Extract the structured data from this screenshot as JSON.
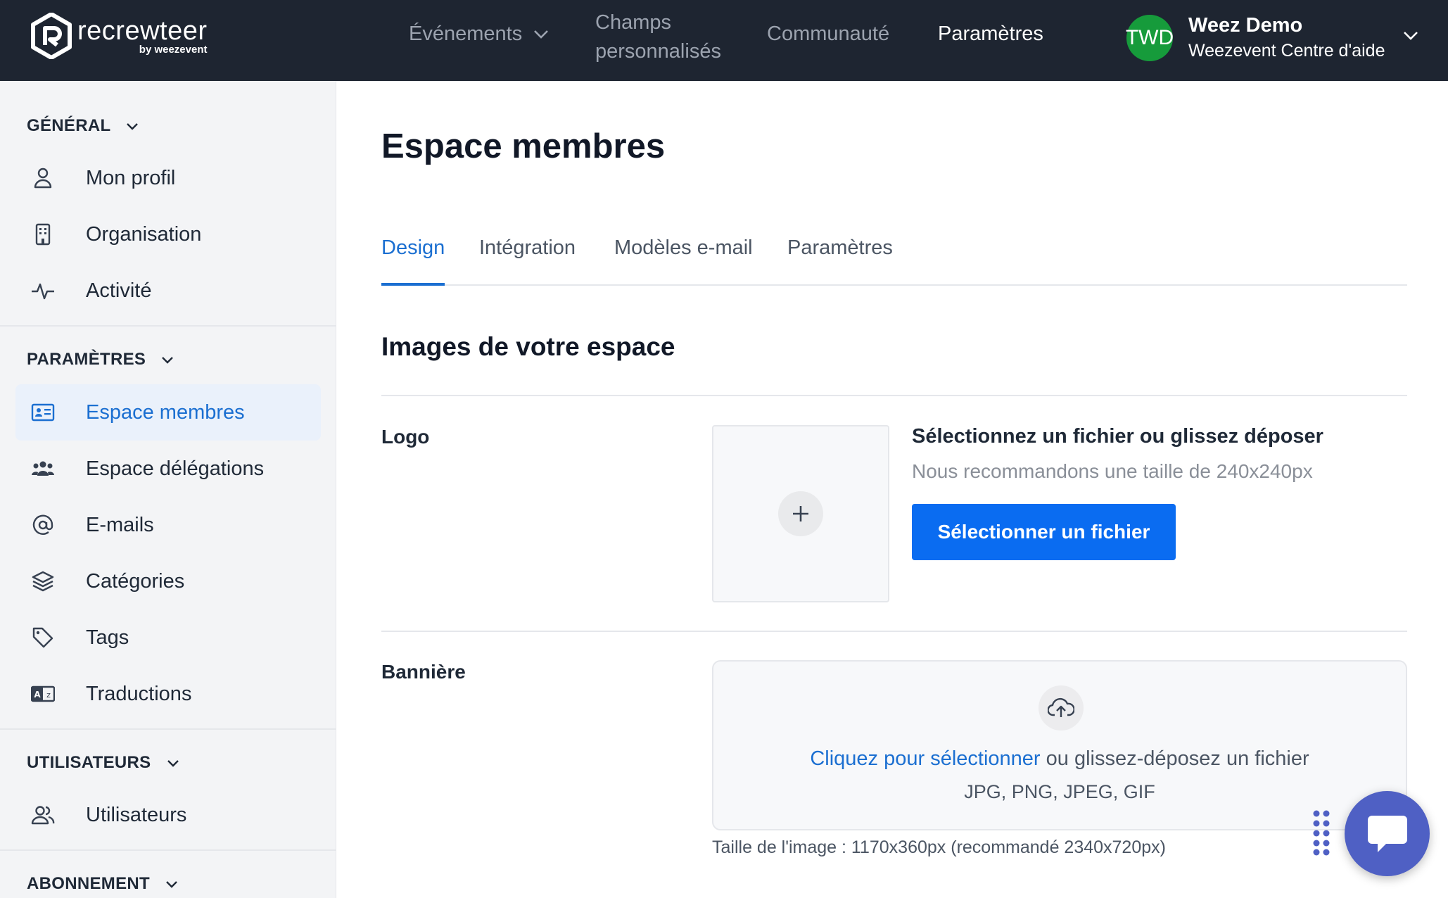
{
  "app": {
    "logo_word": "recrewteer",
    "logo_by": "by weezevent"
  },
  "topnav": {
    "evenements": "Événements",
    "champs_line1": "Champs",
    "champs_line2": "personnalisés",
    "communaute": "Communauté",
    "parametres": "Paramètres",
    "active": "Paramètres"
  },
  "user": {
    "initials": "TWD",
    "name": "Weez Demo",
    "org": "Weezevent Centre d'aide",
    "avatar_color": "#169b3b"
  },
  "sidebar": {
    "general": {
      "title": "GÉNÉRAL",
      "items": [
        {
          "label": "Mon profil",
          "icon": "user-icon"
        },
        {
          "label": "Organisation",
          "icon": "building-icon"
        },
        {
          "label": "Activité",
          "icon": "activity-icon"
        }
      ]
    },
    "parametres": {
      "title": "PARAMÈTRES",
      "items": [
        {
          "label": "Espace membres",
          "icon": "id-card-icon",
          "active": true
        },
        {
          "label": "Espace délégations",
          "icon": "users-group-icon"
        },
        {
          "label": "E-mails",
          "icon": "at-icon"
        },
        {
          "label": "Catégories",
          "icon": "layers-icon"
        },
        {
          "label": "Tags",
          "icon": "tag-icon"
        },
        {
          "label": "Traductions",
          "icon": "translate-icon"
        }
      ]
    },
    "utilisateurs": {
      "title": "UTILISATEURS",
      "items": [
        {
          "label": "Utilisateurs",
          "icon": "users-icon"
        }
      ]
    },
    "abonnement": {
      "title": "ABONNEMENT"
    }
  },
  "main": {
    "title": "Espace membres",
    "tabs": [
      {
        "label": "Design",
        "active": true
      },
      {
        "label": "Intégration"
      },
      {
        "label": "Modèles e-mail"
      },
      {
        "label": "Paramètres"
      }
    ],
    "section_title": "Images de votre espace",
    "logo": {
      "label": "Logo",
      "heading": "Sélectionnez un fichier ou glissez déposer",
      "hint": "Nous recommandons une taille de 240x240px",
      "button": "Sélectionner un fichier"
    },
    "banner": {
      "label": "Bannière",
      "link": "Cliquez pour sélectionner",
      "text": " ou glissez-déposez un fichier",
      "formats": "JPG, PNG, JPEG, GIF",
      "size": "Taille de l'image : 1170x360px (recommandé 2340x720px)"
    }
  },
  "colors": {
    "nav_bg": "#1e2531",
    "accent": "#1b6fd1",
    "primary_button": "#0a6cf1",
    "chat_button": "#4f60c4"
  }
}
